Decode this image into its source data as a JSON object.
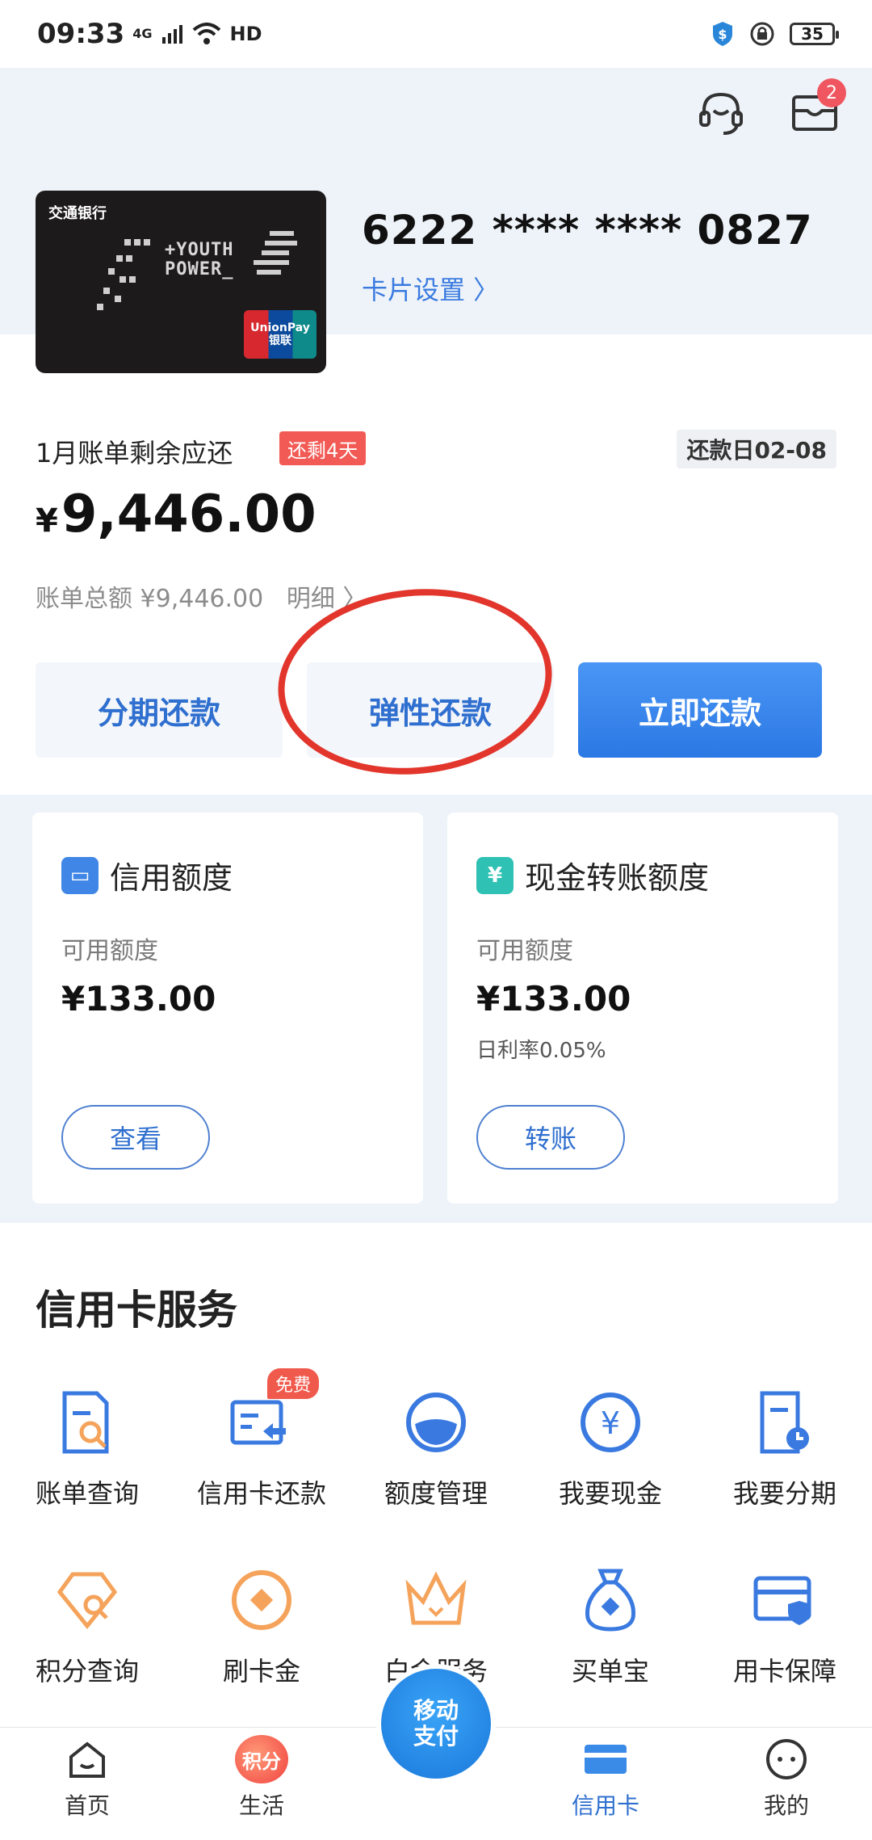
{
  "status_bar": {
    "time": "09:33",
    "network": "4G",
    "hd": "HD",
    "battery": "35"
  },
  "header": {
    "mail_badge": "2"
  },
  "card": {
    "bank_name": "交通银行",
    "art_text": "+YOUTH POWER_",
    "unionpay_text": "UnionPay",
    "unionpay_cn": "银联",
    "number": "6222 **** **** 0827",
    "settings_label": "卡片设置 〉"
  },
  "bill": {
    "label": "1月账单剩余应还",
    "remaining_days": "还剩4天",
    "due_date": "还款日02-08",
    "currency": "¥",
    "amount": "9,446.00",
    "total_line": "账单总额 ¥9,446.00   明细 〉"
  },
  "actions": {
    "installment": "分期还款",
    "flexible": "弹性还款",
    "pay_now": "立即还款"
  },
  "quota": [
    {
      "title": "信用额度",
      "icon_text": "▭",
      "sub": "可用额度",
      "value": "¥133.00",
      "rate": "",
      "button": "查看"
    },
    {
      "title": "现金转账额度",
      "icon_text": "¥",
      "sub": "可用额度",
      "value": "¥133.00",
      "rate": "日利率0.05%",
      "button": "转账"
    }
  ],
  "services": {
    "title": "信用卡服务",
    "free_badge": "免费",
    "items": [
      {
        "label": "账单查询",
        "icon": "bill-search-icon"
      },
      {
        "label": "信用卡还款",
        "icon": "card-repay-icon"
      },
      {
        "label": "额度管理",
        "icon": "quota-manage-icon"
      },
      {
        "label": "我要现金",
        "icon": "cash-icon"
      },
      {
        "label": "我要分期",
        "icon": "installment-icon"
      },
      {
        "label": "积分查询",
        "icon": "points-search-icon"
      },
      {
        "label": "刷卡金",
        "icon": "swipe-gold-icon"
      },
      {
        "label": "白金服务",
        "icon": "crown-icon"
      },
      {
        "label": "买单宝",
        "icon": "money-bag-icon"
      },
      {
        "label": "用卡保障",
        "icon": "card-shield-icon"
      }
    ]
  },
  "bottom_nav": {
    "home": "首页",
    "life": "生活",
    "points_badge": "积分",
    "pay_center": "移动\n支付",
    "credit_card": "信用卡",
    "mine": "我的"
  },
  "colors": {
    "accent": "#2f6fcf",
    "primary_button": "#3d8cf0",
    "alert_red": "#f25a55"
  }
}
